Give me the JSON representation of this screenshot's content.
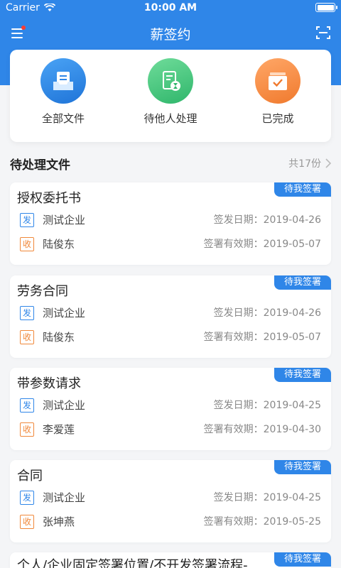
{
  "status_bar": {
    "carrier": "Carrier",
    "time": "10:00 AM"
  },
  "nav": {
    "title": "薪签约",
    "menu_icon": "menu-icon",
    "scan_icon": "scan-icon"
  },
  "colors": {
    "primary": "#2f86e8",
    "green": "#43c97f",
    "orange": "#f0883a",
    "badge_red": "#ff3b30"
  },
  "quick_actions": [
    {
      "label": "全部文件",
      "icon": "document-tray-icon",
      "color": "#2f86e8"
    },
    {
      "label": "待他人处理",
      "icon": "hourglass-document-icon",
      "color": "#43c97f"
    },
    {
      "label": "已完成",
      "icon": "completed-box-icon",
      "color": "#f0883a"
    }
  ],
  "section": {
    "title": "待处理文件",
    "count": "共17份"
  },
  "documents": [
    {
      "title": "授权委托书",
      "badge": "待我签署",
      "sender_tag": "发",
      "sender": "测试企业",
      "issue_label": "签发日期：2019-04-26",
      "receiver_tag": "收",
      "receiver": "陆俊东",
      "expire_label": "签署有效期：2019-05-07"
    },
    {
      "title": "劳务合同",
      "badge": "待我签署",
      "sender_tag": "发",
      "sender": "测试企业",
      "issue_label": "签发日期：2019-04-26",
      "receiver_tag": "收",
      "receiver": "陆俊东",
      "expire_label": "签署有效期：2019-05-07"
    },
    {
      "title": "带参数请求",
      "badge": "待我签署",
      "sender_tag": "发",
      "sender": "测试企业",
      "issue_label": "签发日期：2019-04-25",
      "receiver_tag": "收",
      "receiver": "李爱莲",
      "expire_label": "签署有效期：2019-04-30"
    },
    {
      "title": "合同",
      "badge": "待我签署",
      "sender_tag": "发",
      "sender": "测试企业",
      "issue_label": "签发日期：2019-04-25",
      "receiver_tag": "收",
      "receiver": "张坤燕",
      "expire_label": "签署有效期：2019-05-25"
    },
    {
      "title": "个人/企业固定签署位置/不开发签署流程-",
      "badge": "待我签署"
    }
  ]
}
